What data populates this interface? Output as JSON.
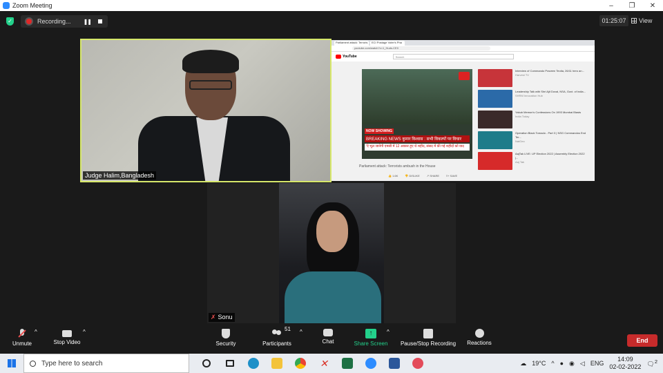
{
  "window": {
    "title": "Zoom Meeting",
    "controls": [
      "–",
      "❐",
      "✕"
    ]
  },
  "recording": {
    "label": "Recording...",
    "pause": "❚❚"
  },
  "timer": "01:25:07",
  "view_label": "View",
  "tiles": [
    {
      "name": "Judge Halim,Bangladesh"
    },
    {
      "name": "Sonu"
    }
  ],
  "shared_screen": {
    "tabs": [
      "Parliament attack: Terroris",
      "ECI Postage Voter's Pha"
    ],
    "address": "youtube.com/watch?v=1_Huds-CE0",
    "search_placeholder": "Search",
    "yt_logo": "YouTube",
    "now_showing": "NOW SHOWING",
    "breaking": "BREAKING NEWS  कुमार विश्वास : सभी विकल्पों पर विचार",
    "ticker": "'ऐ भूल जानेगी एमसी में 12 अवसर हुए थे शहीद, संसद में की गई शहीदों को याद",
    "video_title": "Parliament attack: Terrorists ambush in the House",
    "actions": [
      "👍 1.6K",
      "👎 DISLIKE",
      "↗ SHARE",
      "≡+ SAVE"
    ],
    "sidebar": [
      {
        "title": "Interview of Commando Praveen Teotia, 26/11 hero an...",
        "meta": "Harvest TV"
      },
      {
        "title": "Leadership Talk with Shri Ajit Doval, NSA, Govt. of India...",
        "meta": "SHRM Innovation Hub"
      },
      {
        "title": "Yakub Memon's Confessions On 1993 Mumbai Blasts",
        "meta": "India Today"
      },
      {
        "title": "Operation Black Tornado - Part 3 | NSG Commandos End Ter...",
        "meta": "NatGeo"
      },
      {
        "title": "AajTak LIVE: UP Election 2022 | Assembly Election 2022 |...",
        "meta": "Aaj Tak"
      }
    ],
    "thumb_colors": [
      "#c7343a",
      "#2b6aa8",
      "#3a2a2a",
      "#1e7c8a",
      "#d62a2a"
    ]
  },
  "toolbar": {
    "unmute": "Unmute",
    "stop_video": "Stop Video",
    "security": "Security",
    "participants": "Participants",
    "participants_count": "51",
    "chat": "Chat",
    "share_screen": "Share Screen",
    "record": "Pause/Stop Recording",
    "reactions": "Reactions",
    "end": "End",
    "caret": "^"
  },
  "taskbar": {
    "search_placeholder": "Type here to search",
    "weather": "19°C",
    "lang": "ENG",
    "time": "14:09",
    "date": "02-02-2022",
    "notifications": "2"
  },
  "colors": {
    "accent": "#23d18b",
    "end": "#c72b2b",
    "active_border": "#d7e86a"
  }
}
